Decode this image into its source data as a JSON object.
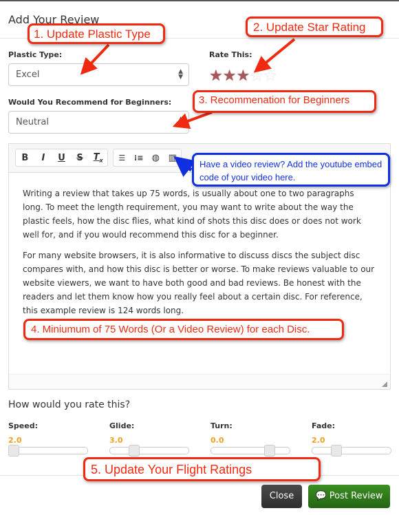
{
  "modal": {
    "title": "Add Your Review"
  },
  "form": {
    "plastic_label": "Plastic Type:",
    "plastic_value": "Excel",
    "rate_label": "Rate This:",
    "rating": 3,
    "rating_max": 5,
    "beginner_label": "Would You Recommend for Beginners:",
    "beginner_value": "Neutral"
  },
  "editor": {
    "toolbar": [
      "bold-icon",
      "italic-icon",
      "underline-icon",
      "strikethrough-icon",
      "clear-format-icon",
      "ordered-list-icon",
      "unordered-list-icon",
      "link-globe-icon",
      "video-film-icon"
    ],
    "paragraphs": [
      "Writing a review that takes up 75 words, is usually about one to two paragraphs long. To meet the length requirement, you may want to write about the way the plastic feels, how the disc flies, what kind of shots this disc does or does not work well for, and if you would recommend this disc for a beginner.",
      "For many website browsers, it is also informative to discuss discs the subject disc compares with, and how this disc is better or worse. To make reviews valuable to our website viewers, we want to have both good and bad reviews. Be honest with the readers and let them know how you really feel about a certain disc. For reference, this example review is 124 words long."
    ]
  },
  "flight": {
    "heading": "How would you rate this?",
    "items": [
      {
        "label": "Speed:",
        "value": "2.0",
        "level": 0.0
      },
      {
        "label": "Glide:",
        "value": "3.0",
        "level": 0.28
      },
      {
        "label": "Turn:",
        "value": "0.0",
        "level": 0.78
      },
      {
        "label": "Fade:",
        "value": "2.0",
        "level": 0.28
      }
    ]
  },
  "footer": {
    "close": "Close",
    "post": "Post Review"
  },
  "annotations": {
    "a1": "1. Update Plastic Type",
    "a2": "2. Update Star Rating",
    "a3": "3. Recommenation for Beginners",
    "a4": "4. Miniumum of 75 Words (Or a Video Review) for each Disc.",
    "a5": "5. Update Your Flight Ratings",
    "video": "Have a video review? Add the youtube embed code of your video here."
  },
  "colors": {
    "accent_value": "#f0a020",
    "star": "#a8585c",
    "post_button": "#2e7d1a",
    "close_button": "#3a3a3a",
    "annotation_red": "#f02a10",
    "annotation_blue": "#1030e0"
  }
}
